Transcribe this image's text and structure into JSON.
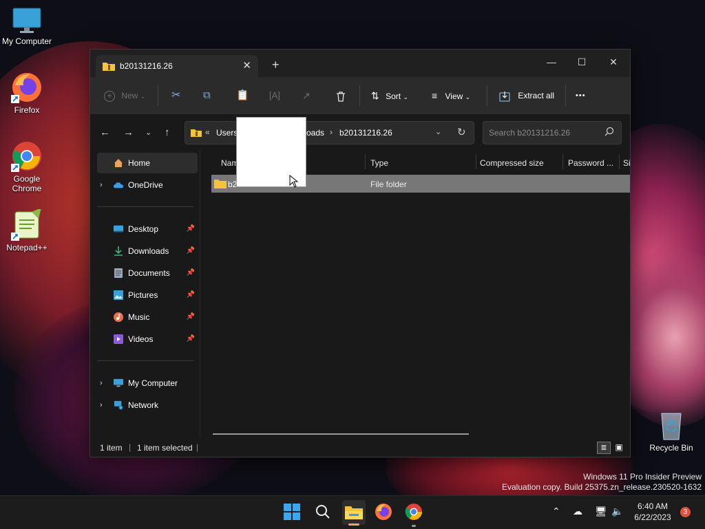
{
  "desktop": {
    "icons": [
      {
        "label": "My Computer"
      },
      {
        "label": "Firefox"
      },
      {
        "label": "Google Chrome"
      },
      {
        "label": "Notepad++"
      },
      {
        "label": "Recycle Bin"
      }
    ]
  },
  "window": {
    "tab_title": "b20131216.26",
    "tab_close": "✕",
    "new_tab": "+",
    "controls": {
      "minimize": "—",
      "maximize": "☐",
      "close": "✕"
    }
  },
  "toolbar": {
    "new_label": "New",
    "sort_label": "Sort",
    "view_label": "View",
    "extract_label": "Extract all",
    "more_label": "•••"
  },
  "address": {
    "overflow": "«",
    "crumbs": [
      "Users",
      "oads",
      "b20131216.26"
    ],
    "search_placeholder": "Search b20131216.26"
  },
  "sidebar": {
    "home": "Home",
    "onedrive": "OneDrive",
    "quick": [
      {
        "label": "Desktop"
      },
      {
        "label": "Downloads"
      },
      {
        "label": "Documents"
      },
      {
        "label": "Pictures"
      },
      {
        "label": "Music"
      },
      {
        "label": "Videos"
      }
    ],
    "my_computer": "My Computer",
    "network": "Network"
  },
  "columns": {
    "name": "Nam",
    "type": "Type",
    "compressed": "Compressed size",
    "password": "Password ...",
    "size": "Si"
  },
  "rows": [
    {
      "name": "b2",
      "type": "File folder"
    }
  ],
  "status": {
    "count": "1 item",
    "selected": "1 item selected"
  },
  "watermark": {
    "line1": "Windows 11 Pro Insider Preview",
    "line2": "Evaluation copy. Build 25375.zn_release.230520-1632"
  },
  "taskbar": {
    "time": "6:40 AM",
    "date": "6/22/2023",
    "badge": "3"
  },
  "colors": {
    "accent": "#0078d4",
    "selected_row": "#777777",
    "folder": "#f3c33b"
  }
}
